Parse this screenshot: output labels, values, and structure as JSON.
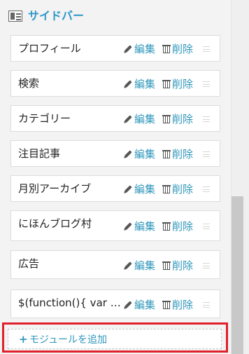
{
  "sidebar": {
    "title": "サイドバー",
    "icon": "sidebar-layout-icon"
  },
  "actions": {
    "edit_label": "編集",
    "delete_label": "削除",
    "edit_icon": "pencil-icon",
    "delete_icon": "trash-icon",
    "drag_icon": "drag-handle-icon"
  },
  "modules": [
    {
      "name": "プロフィール"
    },
    {
      "name": "検索"
    },
    {
      "name": "カテゴリー"
    },
    {
      "name": "注目記事"
    },
    {
      "name": "月別アーカイブ"
    },
    {
      "name": "にほんブログ村"
    },
    {
      "name": "広告"
    },
    {
      "name": "$(function(){ var no..."
    }
  ],
  "add_module": {
    "plus": "+",
    "label": "モジュールを追加"
  },
  "colors": {
    "accent": "#2f97bb",
    "highlight": "#e0202a",
    "background": "#f3f3f3"
  }
}
